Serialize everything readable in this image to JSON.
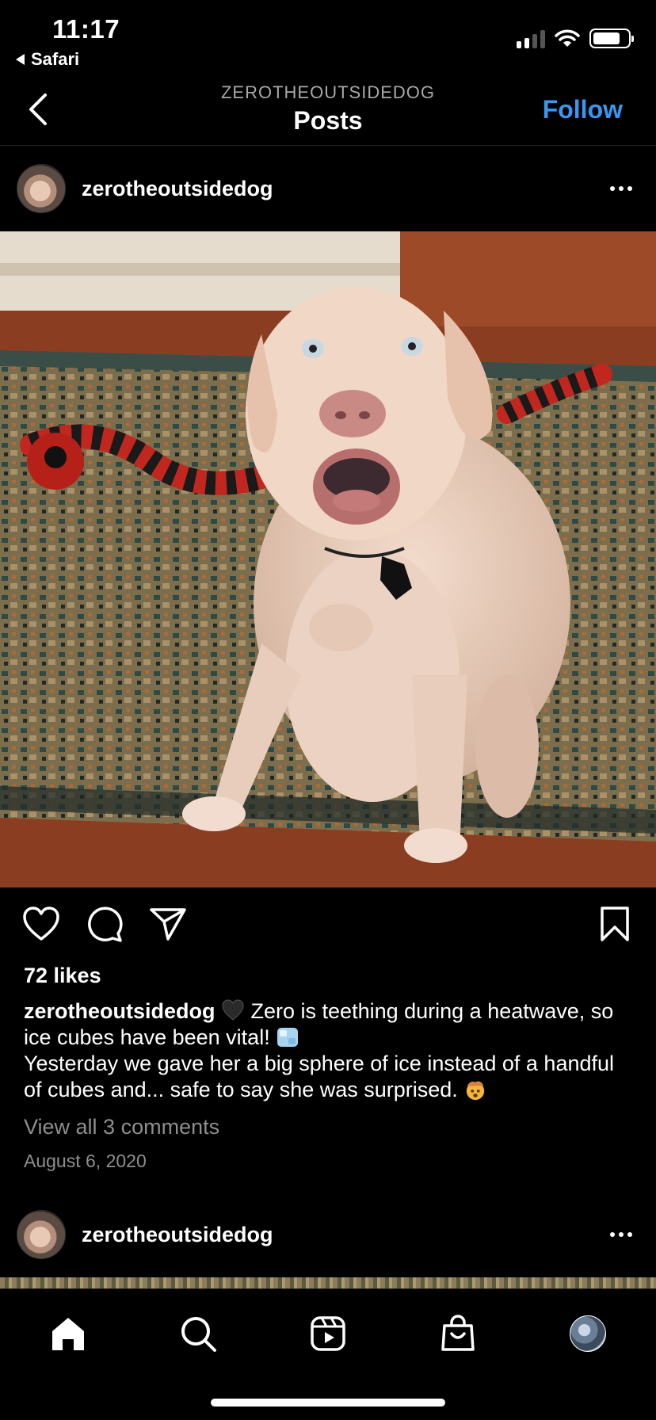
{
  "status_bar": {
    "time": "11:17",
    "back_app": "Safari"
  },
  "header": {
    "subtitle": "ZEROTHEOUTSIDEDOG",
    "title": "Posts",
    "follow_label": "Follow"
  },
  "post": {
    "username": "zerotheoutsidedog",
    "likes": "72 likes",
    "caption_user": "zerotheoutsidedog",
    "caption_line1": " Zero is teething during a heatwave, so ice cubes have been vital! ",
    "caption_line2": "Yesterday we gave her a big sphere of ice instead of a handful of cubes and... safe to say she was surprised. ",
    "view_comments": "View all 3 comments",
    "date": "August 6, 2020"
  },
  "next_post": {
    "username": "zerotheoutsidedog"
  },
  "icons": {
    "status": [
      "signal-icon",
      "wifi-icon",
      "battery-icon"
    ],
    "actions": [
      "heart-icon",
      "comment-icon",
      "share-icon",
      "bookmark-icon"
    ],
    "tabs": [
      "home-icon",
      "search-icon",
      "reels-icon",
      "shop-icon",
      "profile-icon"
    ]
  },
  "colors": {
    "accent": "#3897f0",
    "background": "#000000",
    "secondary_text": "#8e8e8e"
  }
}
